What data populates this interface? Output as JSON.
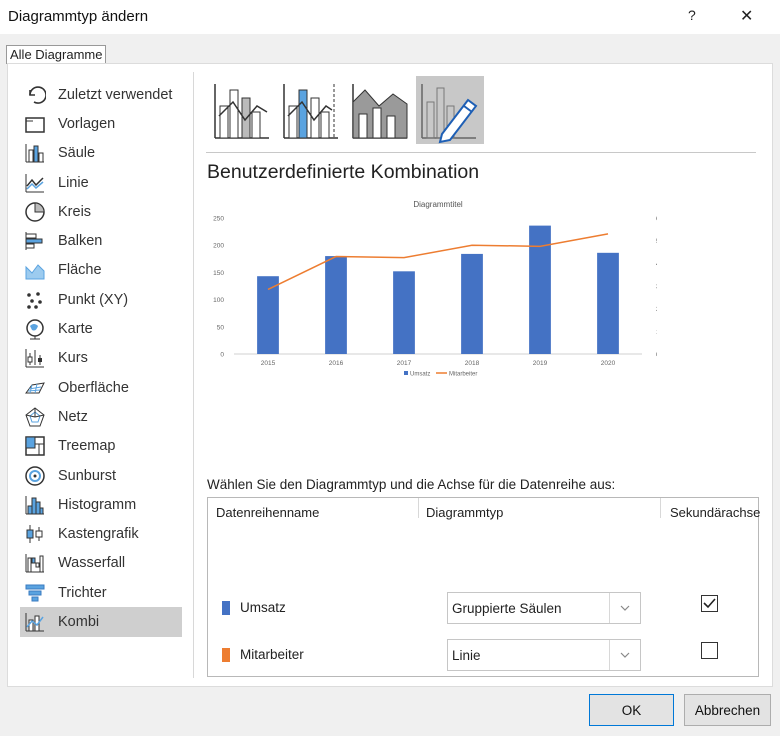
{
  "window": {
    "title": "Diagrammtyp ändern",
    "help": "?",
    "close": "✕"
  },
  "tab": {
    "label": "Alle Diagramme"
  },
  "sidebar": {
    "items": [
      {
        "label": "Zuletzt verwendet",
        "icon": "recent-icon"
      },
      {
        "label": "Vorlagen",
        "icon": "folder-icon"
      },
      {
        "label": "Säule",
        "icon": "column-chart-icon"
      },
      {
        "label": "Linie",
        "icon": "line-chart-icon"
      },
      {
        "label": "Kreis",
        "icon": "pie-chart-icon"
      },
      {
        "label": "Balken",
        "icon": "bar-chart-icon"
      },
      {
        "label": "Fläche",
        "icon": "area-chart-icon"
      },
      {
        "label": "Punkt (XY)",
        "icon": "scatter-chart-icon"
      },
      {
        "label": "Karte",
        "icon": "map-chart-icon"
      },
      {
        "label": "Kurs",
        "icon": "stock-chart-icon"
      },
      {
        "label": "Oberfläche",
        "icon": "surface-chart-icon"
      },
      {
        "label": "Netz",
        "icon": "radar-chart-icon"
      },
      {
        "label": "Treemap",
        "icon": "treemap-icon"
      },
      {
        "label": "Sunburst",
        "icon": "sunburst-icon"
      },
      {
        "label": "Histogramm",
        "icon": "histogram-icon"
      },
      {
        "label": "Kastengrafik",
        "icon": "box-whisker-icon"
      },
      {
        "label": "Wasserfall",
        "icon": "waterfall-icon"
      },
      {
        "label": "Trichter",
        "icon": "funnel-icon"
      },
      {
        "label": "Kombi",
        "icon": "combo-chart-icon",
        "selected": true
      }
    ]
  },
  "subtypes": [
    {
      "icon": "clustered-column-line-icon"
    },
    {
      "icon": "clustered-column-line-secondary-icon"
    },
    {
      "icon": "stacked-area-column-icon"
    },
    {
      "icon": "custom-combination-icon",
      "selected": true
    }
  ],
  "heading": "Benutzerdefinierte Kombination",
  "chart_data": {
    "type": "bar",
    "title": "Diagrammtitel",
    "categories": [
      "2015",
      "2016",
      "2017",
      "2018",
      "2019",
      "2020"
    ],
    "series": [
      {
        "name": "Umsatz",
        "type": "bar",
        "axis": "primary",
        "color": "#4472c4",
        "values": [
          143,
          180,
          152,
          184,
          236,
          186
        ]
      },
      {
        "name": "Mitarbeiter",
        "type": "line",
        "axis": "secondary",
        "color": "#ed7d31",
        "values": [
          285000,
          430000,
          425000,
          480000,
          475000,
          530000
        ]
      }
    ],
    "ylim": [
      0,
      250
    ],
    "yticks": [
      "0",
      "50",
      "100",
      "150",
      "200",
      "250"
    ],
    "y2lim": [
      0,
      600000
    ],
    "y2ticks": [
      "0",
      "100000",
      "200000",
      "300000",
      "400000",
      "500000",
      "600000"
    ],
    "legend": "bottom",
    "grid": false
  },
  "instruction": "Wählen Sie den Diagrammtyp und die Achse für die Datenreihe aus:",
  "table": {
    "headers": {
      "name": "Datenreihenname",
      "type": "Diagrammtyp",
      "secondary": "Sekundärachse"
    },
    "rows": [
      {
        "name": "Umsatz",
        "color": "#4472c4",
        "chart_type": "Gruppierte Säulen",
        "secondary_axis": true
      },
      {
        "name": "Mitarbeiter",
        "color": "#ed7d31",
        "chart_type": "Linie",
        "secondary_axis": false
      }
    ]
  },
  "buttons": {
    "ok": "OK",
    "cancel": "Abbrechen"
  }
}
